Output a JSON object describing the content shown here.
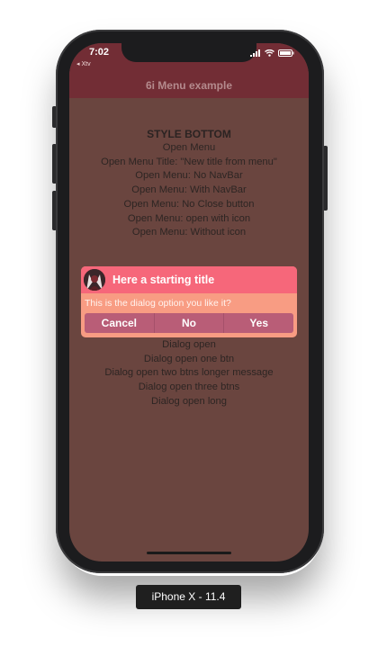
{
  "device": {
    "label": "iPhone X - 11.4"
  },
  "status_bar": {
    "time": "7:02",
    "back_app": "◂ Xtv"
  },
  "navbar": {
    "title": "6i Menu example"
  },
  "menu_section": {
    "heading": "STYLE BOTTOM",
    "items": [
      "Open Menu",
      "Open Menu Title: \"New title from menu\"",
      "Open Menu: No NavBar",
      "Open Menu: With NavBar",
      "Open Menu: No Close button",
      "Open Menu: open with icon",
      "Open Menu: Without icon"
    ]
  },
  "dialog": {
    "title": "Here a starting title",
    "message": "This is the dialog option you like it?",
    "buttons": [
      "Cancel",
      "No",
      "Yes"
    ]
  },
  "dialog_section": {
    "items": [
      "Dialog open",
      "Dialog open one btn",
      "Dialog open two btns longer message",
      "Dialog open three btns",
      "Dialog open long"
    ]
  },
  "icons": {
    "signal": "signal-icon",
    "wifi": "wifi-icon",
    "battery": "battery-icon",
    "avatar": "avatar-icon"
  }
}
